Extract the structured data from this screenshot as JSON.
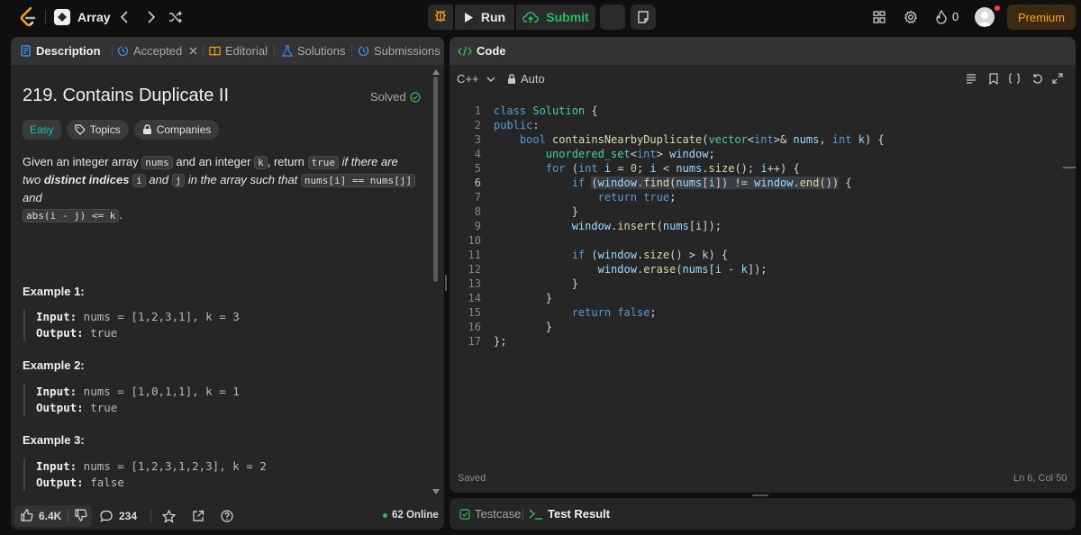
{
  "topbar": {
    "list_title": "Array",
    "run_label": "Run",
    "submit_label": "Submit",
    "streak_count": "0",
    "premium_label": "Premium"
  },
  "left": {
    "tabs": [
      "Description",
      "Accepted",
      "Editorial",
      "Solutions",
      "Submissions"
    ],
    "title": "219. Contains Duplicate II",
    "solved_label": "Solved",
    "tags": [
      "Easy",
      "Topics",
      "Companies"
    ],
    "desc": {
      "p1": "Given an integer array ",
      "nums": "nums",
      "p2": " and an integer ",
      "k": "k",
      "p3": ", return ",
      "true": "true",
      "p4": " if there are two ",
      "distinct": "distinct indices",
      "p5": " ",
      "i": "i",
      "p6": " and ",
      "j": "j",
      "p7": " in the array such that ",
      "eq": "nums[i] == nums[j]",
      "p8": " and ",
      "abs": "abs(i - j) <= k",
      "p9": "."
    },
    "examples": [
      {
        "title": "Example 1:",
        "input_label": "Input:",
        "input": " nums = [1,2,3,1], k = 3",
        "output_label": "Output:",
        "output": " true"
      },
      {
        "title": "Example 2:",
        "input_label": "Input:",
        "input": " nums = [1,0,1,1], k = 1",
        "output_label": "Output:",
        "output": " true"
      },
      {
        "title": "Example 3:",
        "input_label": "Input:",
        "input": " nums = [1,2,3,1,2,3], k = 2",
        "output_label": "Output:",
        "output": " false"
      }
    ],
    "footer": {
      "likes": "6.4K",
      "comments": "234",
      "online": "62 Online"
    }
  },
  "right": {
    "tab_label": "Code",
    "lang": "C++",
    "mode": "Auto",
    "status": "Saved",
    "cursor": "Ln 6, Col 50",
    "line_numbers": [
      "1",
      "2",
      "3",
      "4",
      "5",
      "6",
      "7",
      "8",
      "9",
      "10",
      "11",
      "12",
      "13",
      "14",
      "15",
      "16",
      "17"
    ]
  },
  "bottom": {
    "tabs": [
      "Testcase",
      "Test Result"
    ]
  },
  "colors": {
    "accent_green": "#2cbb5d",
    "premium_orange": "#ffa116",
    "easy_teal": "#1cbaba"
  }
}
